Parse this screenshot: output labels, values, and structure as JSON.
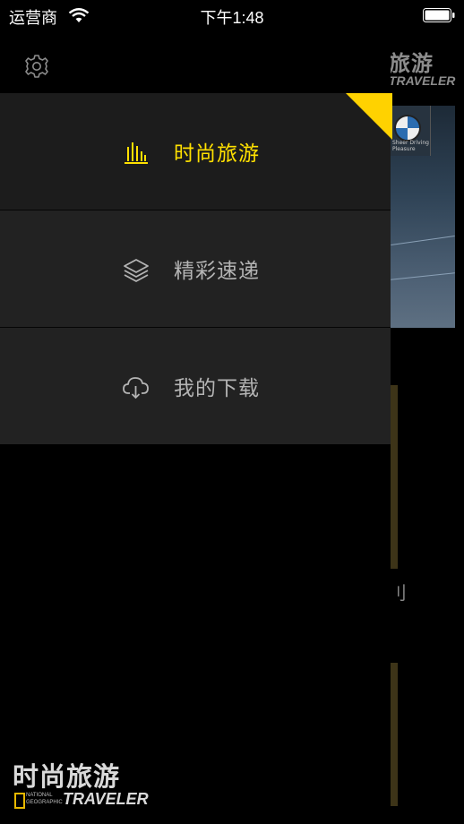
{
  "status_bar": {
    "carrier": "运营商",
    "time": "下午1:48"
  },
  "background": {
    "brand_zh": "旅游",
    "brand_en": "TRAVELER",
    "image_sign": "Sheer Driving Pleasure",
    "fragment": "刂"
  },
  "drawer": {
    "settings_icon": "gear-icon",
    "accent_color": "#ffe000",
    "items": [
      {
        "label": "时尚旅游",
        "icon": "bars-icon",
        "active": true
      },
      {
        "label": "精彩速递",
        "icon": "layers-icon",
        "active": false
      },
      {
        "label": "我的下载",
        "icon": "cloud-download-icon",
        "active": false
      }
    ],
    "footer": {
      "zh": "时尚旅游",
      "ng_line1": "NATIONAL",
      "ng_line2": "GEOGRAPHIC",
      "en": "TRAVELER"
    }
  }
}
